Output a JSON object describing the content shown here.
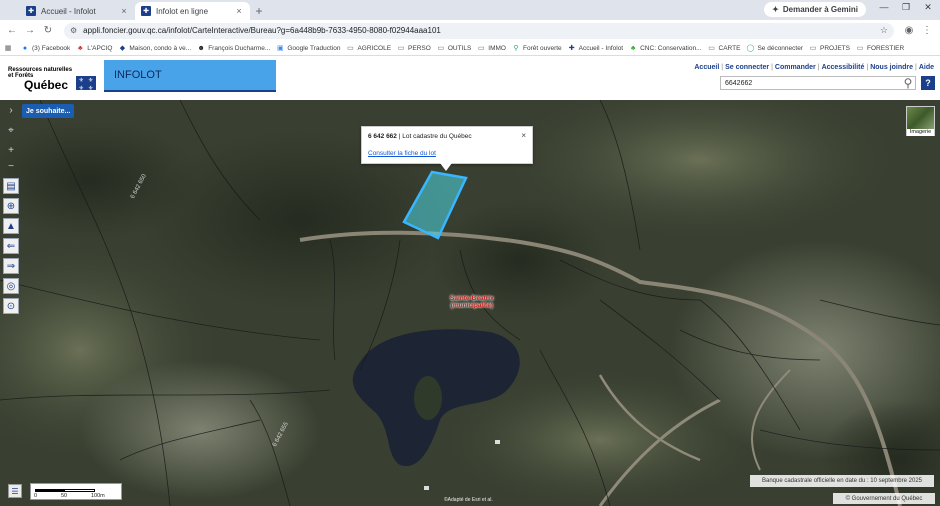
{
  "browser": {
    "tabs": [
      {
        "title": "Accueil - Infolot",
        "active": false
      },
      {
        "title": "Infolot en ligne",
        "active": true
      }
    ],
    "new_tab": "+",
    "gemini_label": "Demander à Gemini",
    "url": "appli.foncier.gouv.qc.ca/infolot/CarteInteractive/Bureau?g=6a448b9b-7633-4950-8080-f02944aaa101",
    "bookmarks": [
      {
        "label": "(3) Facebook",
        "icon": "facebook-icon"
      },
      {
        "label": "L'APCIQ",
        "icon": "leaf-icon"
      },
      {
        "label": "Maison, condo à ve...",
        "icon": "diamond-icon"
      },
      {
        "label": "François Ducharme...",
        "icon": "face-icon"
      },
      {
        "label": "Google Traduction",
        "icon": "translate-icon"
      },
      {
        "label": "AGRICOLE",
        "icon": "folder-icon"
      },
      {
        "label": "PERSO",
        "icon": "folder-icon"
      },
      {
        "label": "OUTILS",
        "icon": "folder-icon"
      },
      {
        "label": "IMMO",
        "icon": "folder-icon"
      },
      {
        "label": "Forêt ouverte",
        "icon": "pin-icon"
      },
      {
        "label": "Accueil - Infolot",
        "icon": "quebec-icon"
      },
      {
        "label": "CNC: Conservation...",
        "icon": "leaf-icon"
      },
      {
        "label": "CARTE",
        "icon": "folder-icon"
      },
      {
        "label": "Se déconnecter",
        "icon": "power-icon"
      },
      {
        "label": "PROJETS",
        "icon": "folder-icon"
      },
      {
        "label": "FORESTIER",
        "icon": "folder-icon"
      }
    ]
  },
  "site": {
    "logo_line1": "Ressources naturelles",
    "logo_line2": "et Forêts",
    "logo_line3": "Québec",
    "brand": "INFOLOT",
    "nav": [
      "Accueil",
      "Se connecter",
      "Commander",
      "Accessibilité",
      "Nous joindre",
      "Aide"
    ],
    "search_value": "6642662",
    "help_label": "?"
  },
  "map": {
    "je_souhaite": "Je souhaite...",
    "popup": {
      "lot_number": "6 642 662",
      "lot_desc": " | Lot cadastre du Québec",
      "link": "Consulter la fiche du lot",
      "close": "×"
    },
    "imagerie_label": "Imagerie",
    "place_label_1": "Sainte-Béatrix",
    "place_label_2": "(municipalité)",
    "lot_labels": [
      "6 642 650",
      "6 642 655"
    ],
    "scale": {
      "t0": "0",
      "t1": "50",
      "t2": "100m"
    },
    "banque": "Banque cadastrale officielle en date du : 10 septembre 2025",
    "copyright": "© Gouvernement du Québec",
    "credit": "©Adapté de Esri et al."
  }
}
